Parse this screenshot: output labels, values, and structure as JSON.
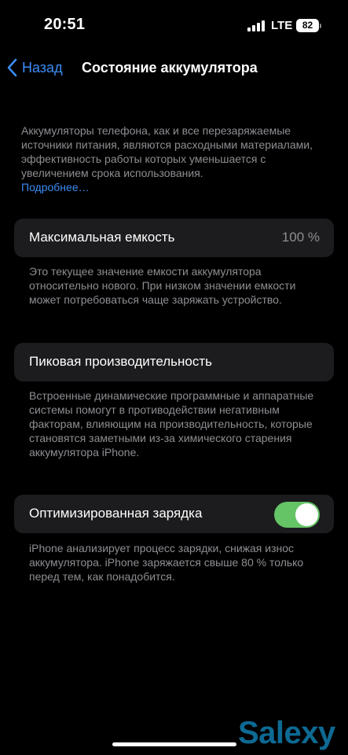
{
  "status_bar": {
    "time": "20:51",
    "network": "LTE",
    "battery_level": "82"
  },
  "nav": {
    "back_label": "Назад",
    "title": "Состояние аккумулятора"
  },
  "intro": {
    "text": "Аккумуляторы телефона, как и все перезаряжаемые источники питания, являются расходными материалами, эффективность работы которых уменьшается с увеличением срока использования.",
    "link": "Подробнее…"
  },
  "max_capacity": {
    "label": "Максимальная емкость",
    "value": "100 %",
    "footer": "Это текущее значение емкости аккумулятора относительно нового. При низком значении емкости может потребоваться чаще заряжать устройство."
  },
  "peak_performance": {
    "label": "Пиковая производительность",
    "footer": "Встроенные динамические программные и аппаратные системы помогут в противодействии негативным факторам, влияющим на производительность, которые становятся заметными из-за химического старения аккумулятора iPhone."
  },
  "optimized_charging": {
    "label": "Оптимизированная зарядка",
    "enabled": true,
    "footer": "iPhone анализирует процесс зарядки, снижая износ аккумулятора. iPhone заряжается свыше 80 % только перед тем, как понадобится."
  },
  "watermark": "Salexy",
  "colors": {
    "background": "#000000",
    "cell": "#1c1c1e",
    "accent": "#3b8cf5",
    "toggle_on": "#65c466",
    "secondary_text": "#8e8e93"
  }
}
